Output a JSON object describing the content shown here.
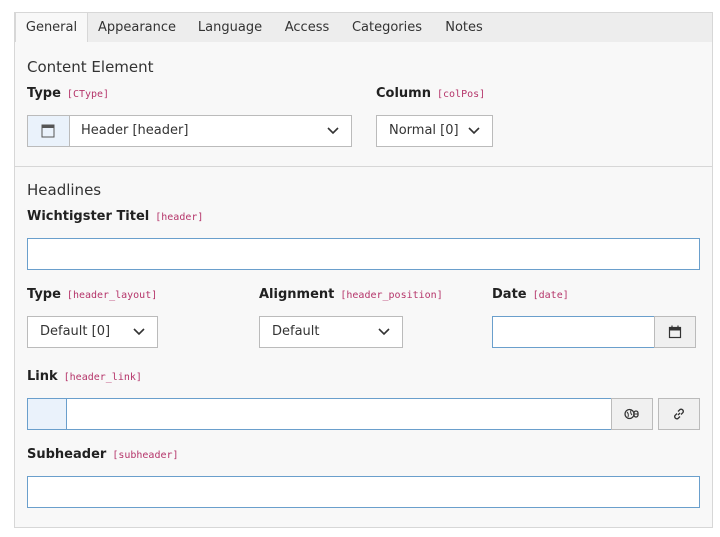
{
  "tabs": [
    {
      "label": "General",
      "active": true
    },
    {
      "label": "Appearance"
    },
    {
      "label": "Language"
    },
    {
      "label": "Access"
    },
    {
      "label": "Categories"
    },
    {
      "label": "Notes"
    }
  ],
  "content_element": {
    "title": "Content Element",
    "type": {
      "label": "Type",
      "code": "[CType]",
      "value": "Header [header]",
      "icon": "content-header-icon"
    },
    "column": {
      "label": "Column",
      "code": "[colPos]",
      "value": "Normal [0]"
    }
  },
  "headlines": {
    "title": "Headlines",
    "header": {
      "label": "Wichtigster Titel",
      "code": "[header]",
      "value": ""
    },
    "header_layout": {
      "label": "Type",
      "code": "[header_layout]",
      "value": "Default [0]"
    },
    "header_position": {
      "label": "Alignment",
      "code": "[header_position]",
      "value": "Default"
    },
    "date": {
      "label": "Date",
      "code": "[date]",
      "value": "",
      "icon": "calendar-icon"
    },
    "link": {
      "label": "Link",
      "code": "[header_link]",
      "value": "",
      "icons": [
        "link-browser-icon",
        "link-icon"
      ]
    },
    "subheader": {
      "label": "Subheader",
      "code": "[subheader]",
      "value": ""
    }
  },
  "colors": {
    "accent_border": "#6a9fcc",
    "code": "#b5356a",
    "panel": "#f8f8f8"
  }
}
